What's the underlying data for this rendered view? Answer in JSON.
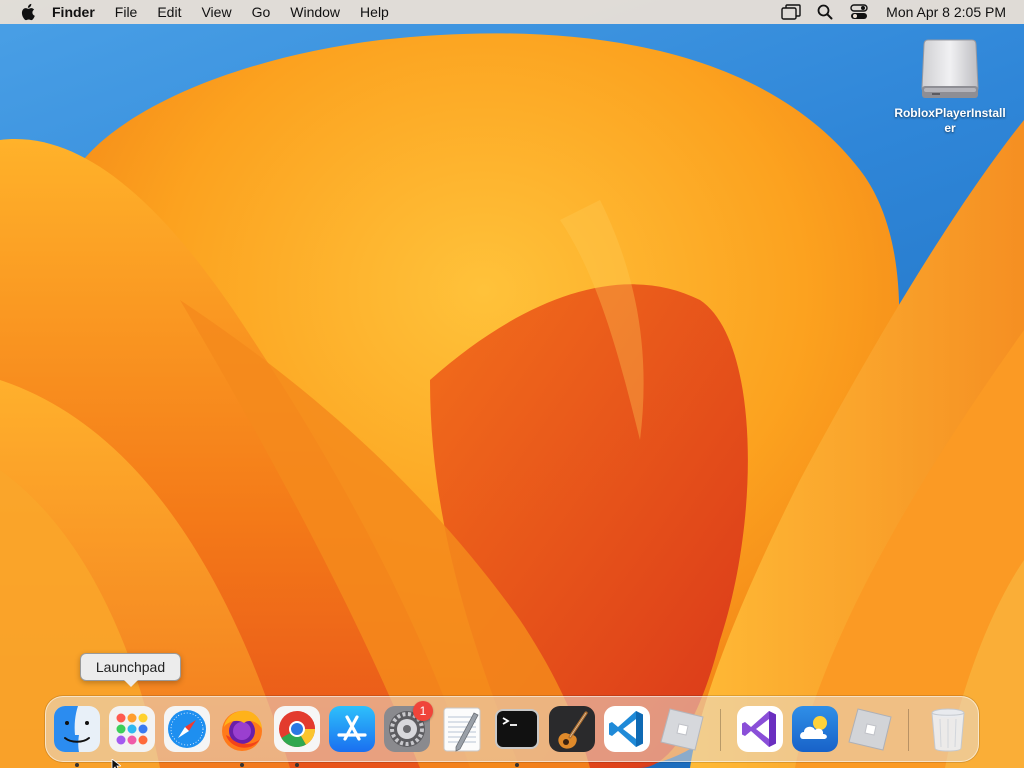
{
  "menubar": {
    "app_name": "Finder",
    "menus": [
      "File",
      "Edit",
      "View",
      "Go",
      "Window",
      "Help"
    ],
    "status_icons": [
      "screen-mirroring-icon",
      "spotlight-search-icon",
      "control-center-icon"
    ],
    "clock": "Mon Apr 8  2:05 PM"
  },
  "desktop": {
    "icons": [
      {
        "label": "RobloxPlayerInstaller",
        "icon": "external-drive-icon"
      }
    ]
  },
  "tooltip": {
    "label": "Launchpad"
  },
  "dock": {
    "apps": [
      {
        "name": "Finder",
        "icon": "finder-icon",
        "running": true
      },
      {
        "name": "Launchpad",
        "icon": "launchpad-icon",
        "running": false
      },
      {
        "name": "Safari",
        "icon": "safari-icon",
        "running": false
      },
      {
        "name": "Firefox",
        "icon": "firefox-icon",
        "running": true
      },
      {
        "name": "Google Chrome",
        "icon": "chrome-icon",
        "running": true
      },
      {
        "name": "App Store",
        "icon": "app-store-icon",
        "running": false
      },
      {
        "name": "System Settings",
        "icon": "settings-gear-icon",
        "running": false,
        "badge": "1"
      },
      {
        "name": "TextEdit",
        "icon": "textedit-icon",
        "running": false
      },
      {
        "name": "Terminal",
        "icon": "terminal-icon",
        "running": true
      },
      {
        "name": "GarageBand",
        "icon": "garageband-guitar-icon",
        "running": false
      },
      {
        "name": "Visual Studio Code",
        "icon": "vscode-icon",
        "running": false
      },
      {
        "name": "Roblox",
        "icon": "roblox-icon",
        "running": false
      }
    ],
    "recent_apps": [
      {
        "name": "Visual Studio",
        "icon": "visual-studio-icon"
      },
      {
        "name": "Weather",
        "icon": "weather-icon"
      },
      {
        "name": "Roblox Studio",
        "icon": "roblox-studio-icon"
      }
    ],
    "trash": {
      "name": "Trash",
      "icon": "trash-icon"
    }
  },
  "colors": {
    "menubar_bg": "#eee2d6",
    "wallpaper_orange": "#f79a1e",
    "wallpaper_blue": "#2f86d8",
    "badge_red": "#f0443a"
  }
}
